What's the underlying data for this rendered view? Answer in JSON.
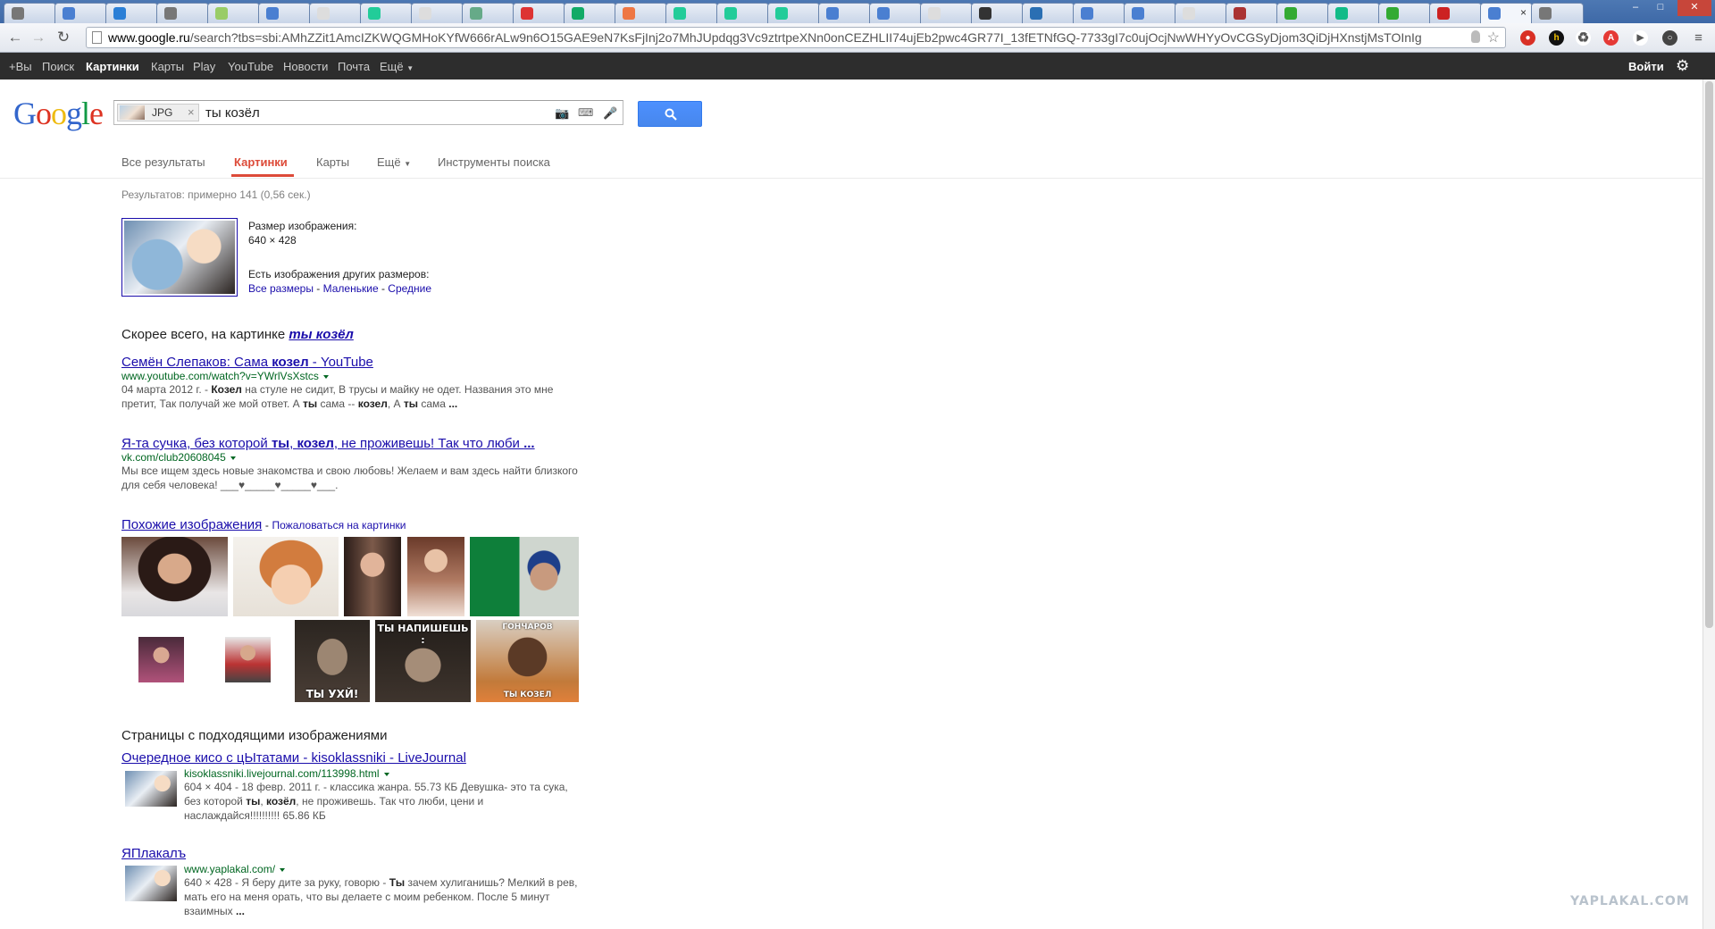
{
  "browser": {
    "url_host": "www.google.ru",
    "url_rest": "/search?tbs=sbi:AMhZZit1AmcIZKWQGMHoKYfW666rALw9n6O15GAE9eN7KsFjInj2o7MhJUpdqg3Vc9ztrtpeXNn0onCEZHLII74ujEb2pwc4GR77I_13fETNfGQ-7733gI7c0ujOcjNwWHYyOvCGSyDjom3QiDjHXnstjMsTOInIg",
    "tab_count": 31,
    "active_tab_close": "×"
  },
  "gbar": {
    "plus_you": "+Вы",
    "search": "Поиск",
    "images": "Картинки",
    "maps": "Карты",
    "play": "Play",
    "youtube": "YouTube",
    "news": "Новости",
    "mail": "Почта",
    "more": "Ещё",
    "signin": "Войти"
  },
  "search": {
    "chip_label": "JPG",
    "chip_close": "×",
    "query": "ты козёл"
  },
  "logo_letters": [
    {
      "ch": "G",
      "color": "#3366cc"
    },
    {
      "ch": "o",
      "color": "#dd3322"
    },
    {
      "ch": "o",
      "color": "#eebb11"
    },
    {
      "ch": "g",
      "color": "#3366cc"
    },
    {
      "ch": "l",
      "color": "#119944"
    },
    {
      "ch": "e",
      "color": "#dd3322"
    }
  ],
  "tabs": {
    "all": "Все результаты",
    "images": "Картинки",
    "maps": "Карты",
    "more": "Ещё",
    "tools": "Инструменты поиска"
  },
  "stats": "Результатов: примерно 141 (0,56 сек.)",
  "image_info": {
    "size_label": "Размер изображения:",
    "size_value": "640 × 428",
    "other_sizes": "Есть изображения других размеров:",
    "all_sizes": "Все размеры",
    "small": "Маленькие",
    "medium": "Средние"
  },
  "best_guess": {
    "prefix": "Скорее всего, на картинке",
    "term": "ты козёл"
  },
  "results": [
    {
      "title_pre": "Семён Слепаков: Сама ",
      "title_bold": "козел",
      "title_post": " - YouTube",
      "url": "www.youtube.com/watch?v=YWrlVsXstcs",
      "snippet_html": "04 марта 2012 г. - <b>Козел</b> на стуле не сидит, В трусы и майку не одет. Названия это мне претит, Так получай же мой ответ. А <b>ты</b> сама -- <b>козел</b>, А <b>ты</b> сама <b>...</b>"
    },
    {
      "title_html": "Я-та сучка, без которой <b>ты</b>, <b>козел</b>, не проживешь! Так что люби <b>...</b>",
      "url": "vk.com/club20608045",
      "snippet_html": "Мы все ищем здесь новые знакомства и свою любовь! Желаем и вам здесь найти близкого для себя человека! ___♥_____♥_____♥___."
    }
  ],
  "similar": {
    "title": "Похожие изображения",
    "report": "Пожаловаться на картинки",
    "meme1_bottom": "ТЫ УХЙ!",
    "meme2_top": "ТЫ НАПИШЕШЬ :",
    "meme3_top": "ГОНЧАРОВ",
    "meme3_bottom": "ТЫ КОЗЕЛ"
  },
  "pages_heading": "Страницы с подходящими изображениями",
  "pages": [
    {
      "title": "Очередное кисо с цЫтатами - kisoklassniki - LiveJournal",
      "url": "kisoklassniki.livejournal.com/113998.html",
      "snippet_html": "604 × 404 - 18 февр. 2011 г. - классика жанра. 55.73 КБ Девушка- это та сука, без которой <b>ты</b>, <b>козёл</b>, не проживешь. Так что люби, цени и наслаждайся!!!!!!!!!! 65.86 КБ"
    },
    {
      "title": "ЯПлакалъ",
      "url": "www.yaplakal.com/",
      "snippet_html": "640 × 428 - Я беру дите за руку, говорю - <b>Ты</b> зачем хулиганишь? Мелкий в рев, мать его на меня орать, что вы делаете с моим ребенком. После 5 минут взаимных <b>...</b>"
    }
  ],
  "watermark": "YAPLAKAL.COM",
  "colors": {
    "link": "#1a0dab",
    "url_green": "#006621",
    "tab_selected": "#dd4b39",
    "search_button": "#4d90fe"
  }
}
